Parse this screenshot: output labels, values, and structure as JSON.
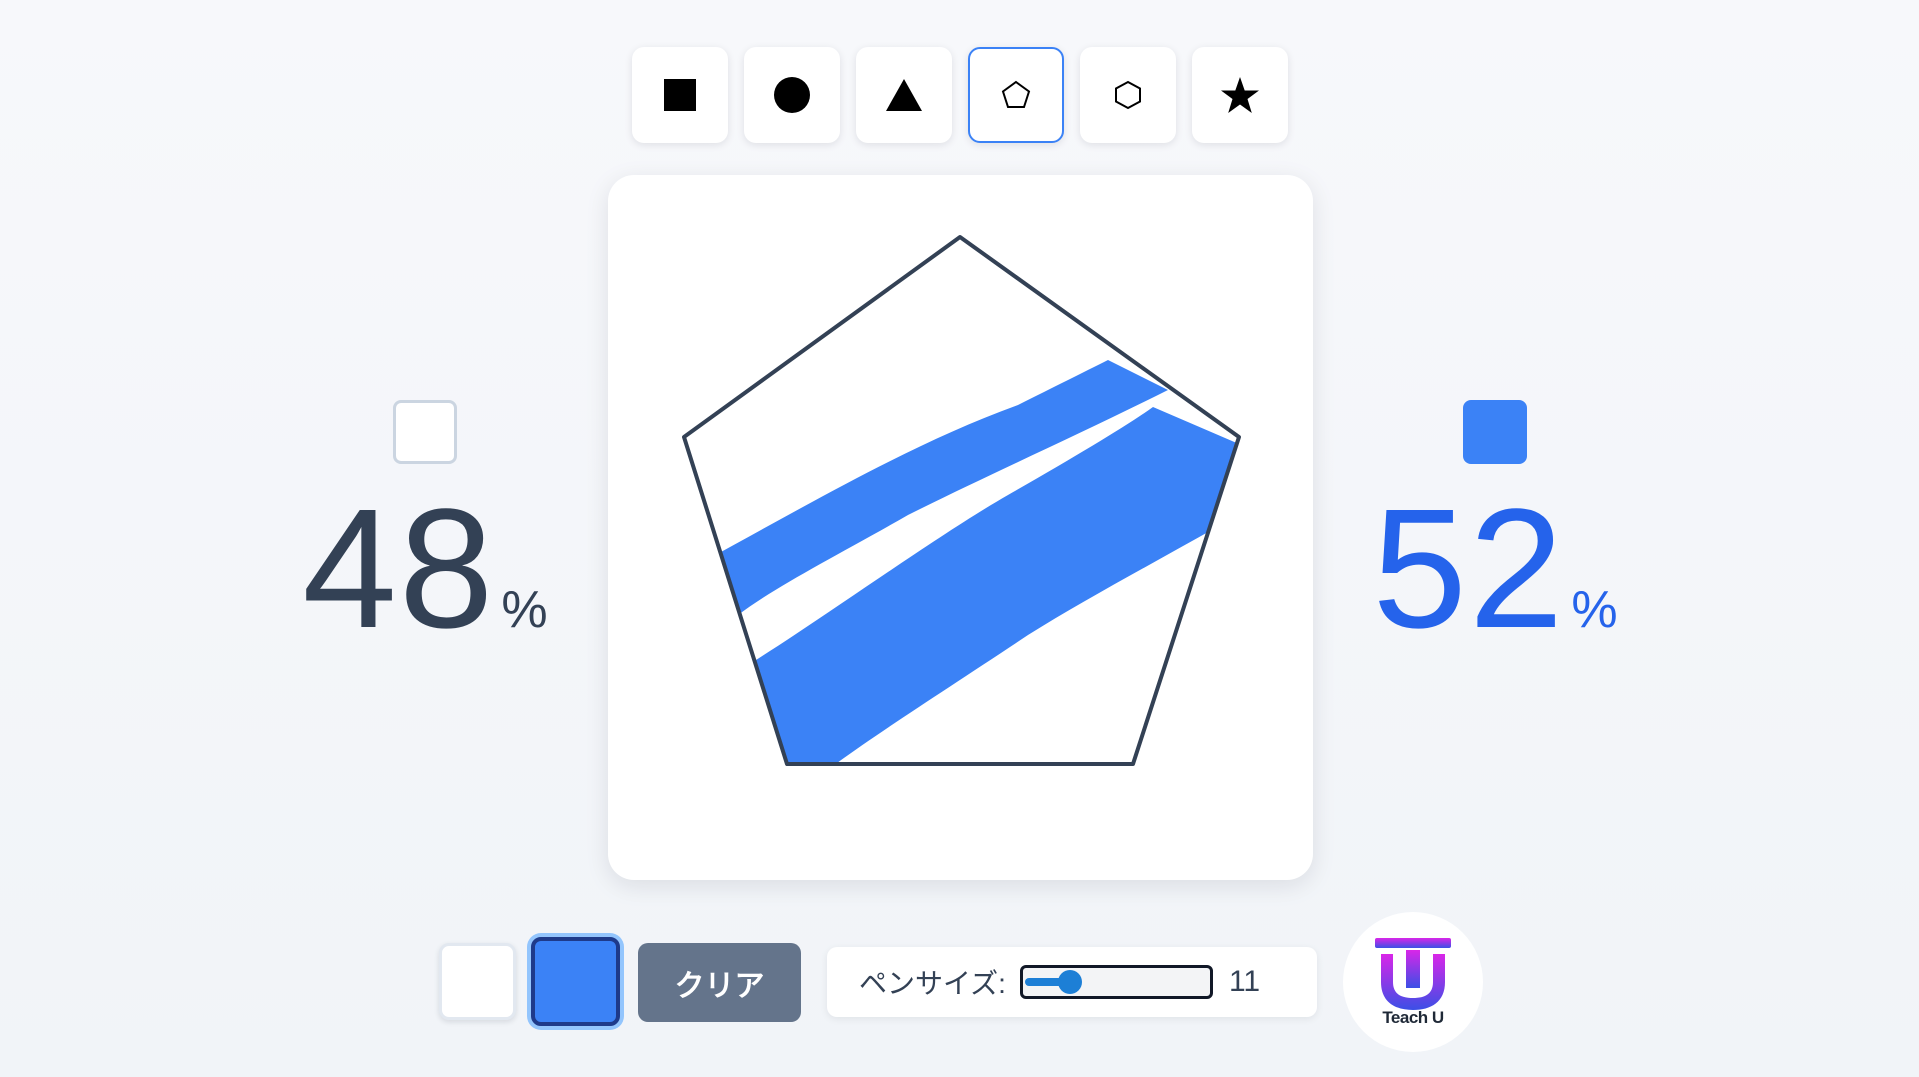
{
  "toolbar": {
    "shapes": [
      {
        "id": "square",
        "icon": "square-icon",
        "active": false
      },
      {
        "id": "circle",
        "icon": "circle-icon",
        "active": false
      },
      {
        "id": "triangle",
        "icon": "triangle-icon",
        "active": false
      },
      {
        "id": "pentagon",
        "icon": "pentagon-icon",
        "active": true
      },
      {
        "id": "hexagon",
        "icon": "hexagon-icon",
        "active": false
      },
      {
        "id": "star",
        "icon": "star-icon",
        "active": false
      }
    ]
  },
  "stats": {
    "white": {
      "value": "48",
      "unit": "%",
      "color": "#ffffff"
    },
    "blue": {
      "value": "52",
      "unit": "%",
      "color": "#3b82f6"
    }
  },
  "controls": {
    "colors": [
      {
        "name": "white",
        "hex": "#ffffff",
        "selected": false
      },
      {
        "name": "blue",
        "hex": "#3b82f6",
        "selected": true
      }
    ],
    "clear_label": "クリア",
    "pen_label": "ペンサイズ:",
    "pen_value": "11",
    "pen_fraction": 0.2
  },
  "logo": {
    "text": "Teach U"
  },
  "colors": {
    "accent": "#3b82f6",
    "outline": "#334155",
    "clear_button": "#64748b"
  }
}
